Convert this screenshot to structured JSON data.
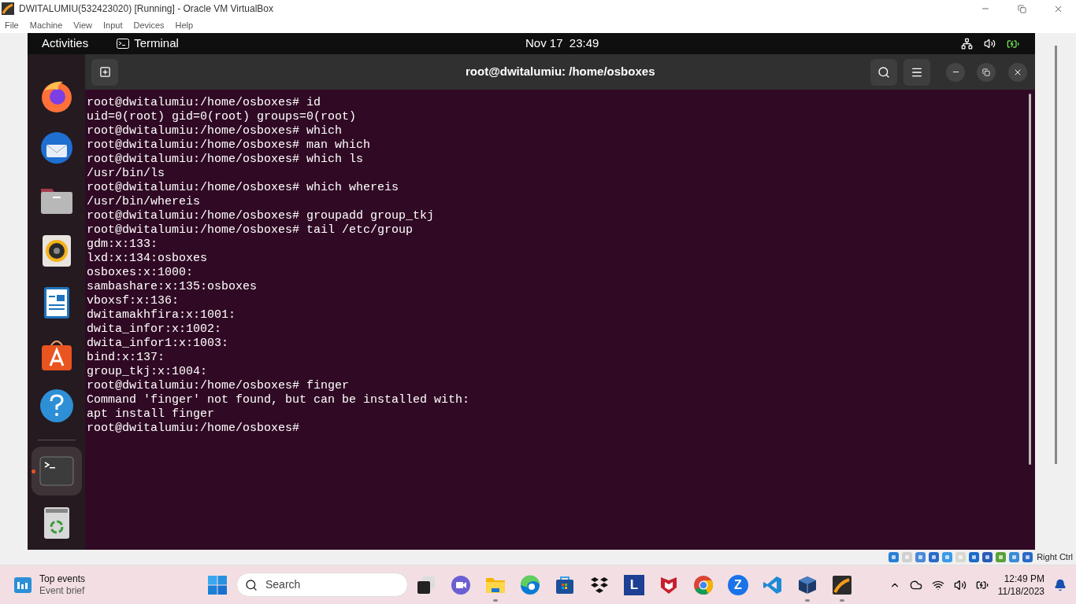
{
  "window": {
    "title": "DWITALUMIU(532423020) [Running] - Oracle VM VirtualBox"
  },
  "menu": [
    "File",
    "Machine",
    "View",
    "Input",
    "Devices",
    "Help"
  ],
  "topbar": {
    "activities": "Activities",
    "app": "Terminal",
    "clock": "Nov 17  23:49"
  },
  "dock": [
    {
      "kind": "firefox",
      "active": false
    },
    {
      "kind": "thunderbird",
      "active": false
    },
    {
      "kind": "files",
      "active": false
    },
    {
      "kind": "rhythmbox",
      "active": false
    },
    {
      "kind": "writer",
      "active": false
    },
    {
      "kind": "software",
      "active": false
    },
    {
      "kind": "help",
      "active": false
    },
    {
      "kind": "terminal",
      "active": true
    },
    {
      "kind": "trash",
      "active": false
    }
  ],
  "terminal": {
    "title": "root@dwitalumiu: /home/osboxes",
    "lines": [
      "root@dwitalumiu:/home/osboxes# id",
      "uid=0(root) gid=0(root) groups=0(root)",
      "root@dwitalumiu:/home/osboxes# which",
      "root@dwitalumiu:/home/osboxes# man which",
      "root@dwitalumiu:/home/osboxes# which ls",
      "/usr/bin/ls",
      "root@dwitalumiu:/home/osboxes# which whereis",
      "/usr/bin/whereis",
      "root@dwitalumiu:/home/osboxes# groupadd group_tkj",
      "root@dwitalumiu:/home/osboxes# tail /etc/group",
      "gdm:x:133:",
      "lxd:x:134:osboxes",
      "osboxes:x:1000:",
      "sambashare:x:135:osboxes",
      "vboxsf:x:136:",
      "dwitamakhfira:x:1001:",
      "dwita_infor:x:1002:",
      "dwita_infor1:x:1003:",
      "bind:x:137:",
      "group_tkj:x:1004:",
      "root@dwitalumiu:/home/osboxes# finger",
      "Command 'finger' not found, but can be installed with:",
      "apt install finger",
      "root@dwitalumiu:/home/osboxes#"
    ]
  },
  "vm_status": {
    "host_key": "Right Ctrl"
  },
  "taskbar": {
    "widget_title": "Top events",
    "widget_subtitle": "Event brief",
    "search_placeholder": "Search",
    "apps": [
      {
        "kind": "taskview",
        "running": false
      },
      {
        "kind": "meet",
        "running": false
      },
      {
        "kind": "explorer",
        "running": true
      },
      {
        "kind": "edge",
        "running": false
      },
      {
        "kind": "store",
        "running": false
      },
      {
        "kind": "dropbox",
        "running": false
      },
      {
        "kind": "letter",
        "label": "L",
        "running": false
      },
      {
        "kind": "mcafee",
        "running": false
      },
      {
        "kind": "chrome",
        "running": false
      },
      {
        "kind": "zoom",
        "label": "Z",
        "running": false
      },
      {
        "kind": "vscode",
        "running": false
      },
      {
        "kind": "virtualbox",
        "running": true
      },
      {
        "kind": "ghostscript",
        "running": true
      }
    ],
    "time": "12:49 PM",
    "date": "11/18/2023"
  }
}
